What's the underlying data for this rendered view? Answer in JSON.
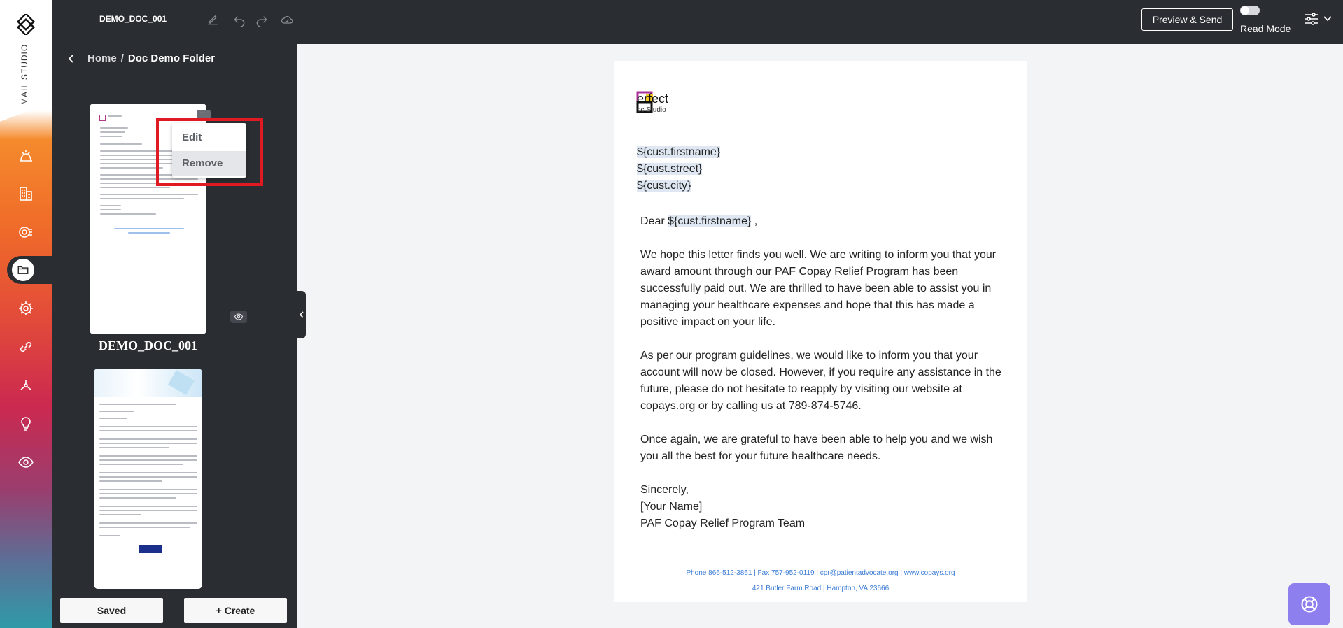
{
  "app": {
    "brand": "MAIL STUDIO",
    "logo_icon": "mail-studio-logo"
  },
  "rail": {
    "items": [
      {
        "icon": "dashboard-icon"
      },
      {
        "icon": "templates-icon"
      },
      {
        "icon": "analytics-icon"
      },
      {
        "icon": "folder-icon",
        "active": true
      },
      {
        "icon": "gear-icon"
      },
      {
        "icon": "link-icon"
      },
      {
        "icon": "network-icon"
      },
      {
        "icon": "bulb-icon"
      },
      {
        "icon": "eye-icon"
      }
    ]
  },
  "topbar": {
    "doc_title": "DEMO_DOC_001",
    "preview_label": "Preview & Send",
    "read_mode_label": "Read Mode",
    "read_mode_on": false
  },
  "panel": {
    "breadcrumb": {
      "home": "Home",
      "separator": "/",
      "folder": "Doc Demo Folder"
    },
    "cards": [
      {
        "name": "DEMO_DOC_001"
      },
      {
        "name": ""
      }
    ],
    "context_menu": {
      "edit": "Edit",
      "remove": "Remove"
    },
    "footer": {
      "saved": "Saved",
      "create": "+ Create"
    }
  },
  "letter": {
    "logo": {
      "line1": "erfect",
      "line2": "oc Studio"
    },
    "address": [
      "${cust.firstname}",
      "${cust.street}",
      "${cust.city}"
    ],
    "greeting_prefix": "Dear",
    "greeting_var": "${cust.firstname}",
    "greeting_suffix": ",",
    "paragraphs": [
      "We hope this letter finds you well. We are writing to inform you that your award amount through our PAF Copay Relief Program has been successfully paid out. We are thrilled to have been able to assist you in managing your healthcare expenses and hope that this has made a positive impact on your life.",
      "As per our program guidelines, we would like to inform you that your account will now be closed. However, if you require any assistance in the future, please do not hesitate to reapply by visiting our website at copays.org or by calling us at 789-874-5746.",
      "Once again, we are grateful to have been able to help you and we wish you all the best for your future healthcare needs."
    ],
    "closing": [
      "Sincerely,",
      "[Your Name]",
      "PAF Copay Relief Program Team"
    ],
    "footer_line1": "Phone 866-512-3861 | Fax 757-952-0119 | cpr@patientadvocate.org | www.copays.org",
    "footer_line2": "421 Butler Farm Road | Hampton, VA 23666"
  },
  "colors": {
    "dark": "#2a2d31",
    "accent_orange": "#f58a2c",
    "highlight_red": "#e01a22",
    "link_blue": "#3a7bd5",
    "fab_purple": "#8e7fee"
  }
}
